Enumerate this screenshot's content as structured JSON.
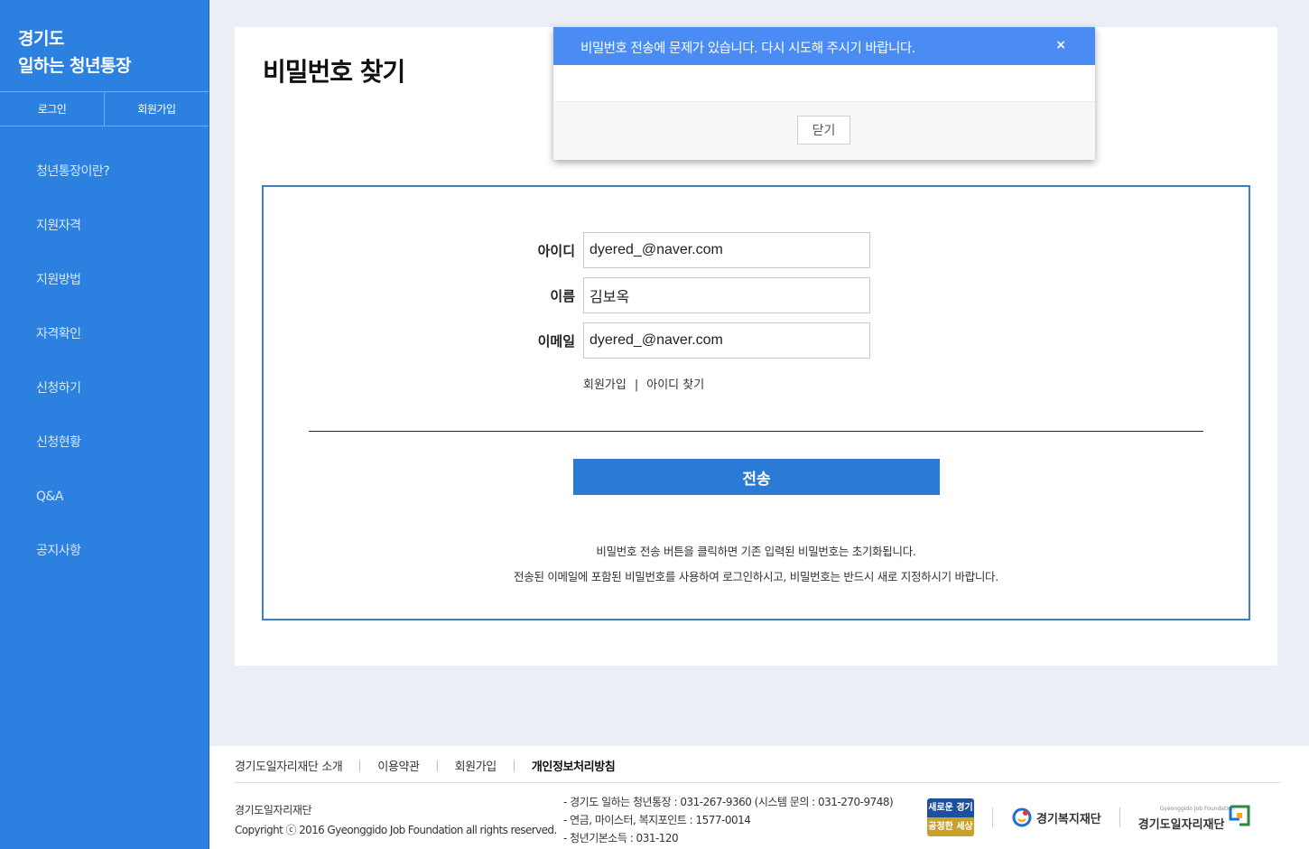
{
  "sidebar": {
    "brand_line1": "경기도",
    "brand_line2": "일하는 청년통장",
    "login": "로그인",
    "signup": "회원가입",
    "menu": [
      "청년통장이란?",
      "지원자격",
      "지원방법",
      "자격확인",
      "신청하기",
      "신청현황",
      "Q&A",
      "공지사항"
    ]
  },
  "main": {
    "title": "비밀번호 찾기",
    "form": {
      "id_label": "아이디",
      "id_value": "dyered_@naver.com",
      "name_label": "이름",
      "name_value": "김보옥",
      "email_label": "이메일",
      "email_value": "dyered_@naver.com",
      "link_signup": "회원가입",
      "link_sep": "|",
      "link_find_id": "아이디 찾기",
      "submit": "전송",
      "notice1": "비밀번호 전송 버튼을 클릭하면 기존 입력된 비밀번호는 초기화됩니다.",
      "notice2": "전송된 이메일에 포함된 비밀번호를 사용하여 로그인하시고, 비밀번호는 반드시 새로 지정하시기 바랍니다."
    }
  },
  "modal": {
    "message": "비밀번호 전송에 문제가 있습니다. 다시 시도해 주시기 바랍니다.",
    "close_symbol": "×",
    "close_button": "닫기"
  },
  "footer": {
    "nav": [
      "경기도일자리재단 소개",
      "이용약관",
      "회원가입",
      "개인정보처리방침"
    ],
    "org": "경기도일자리재단",
    "copyright": "Copyright ⓒ 2016 Gyeonggido Job Foundation all rights reserved.",
    "contacts": [
      "- 경기도 일하는 청년통장 : 031-267-9360 (시스템 문의 : 031-270-9748)",
      "- 연금, 마이스터, 복지포인트 : 1577-0014",
      "- 청년기본소득 : 031-120"
    ],
    "logos": {
      "badge_top": "새로운 경기",
      "badge_bottom": "공정한 세상",
      "welfare": "경기복지재단",
      "job_sub": "Gyeonggido Job Foundation",
      "job": "경기도일자리재단"
    }
  },
  "colors": {
    "sidebar": "#2b80e0",
    "accent": "#2b7ad6",
    "modal_header": "#4a8cf4",
    "background": "#ebeff5"
  }
}
